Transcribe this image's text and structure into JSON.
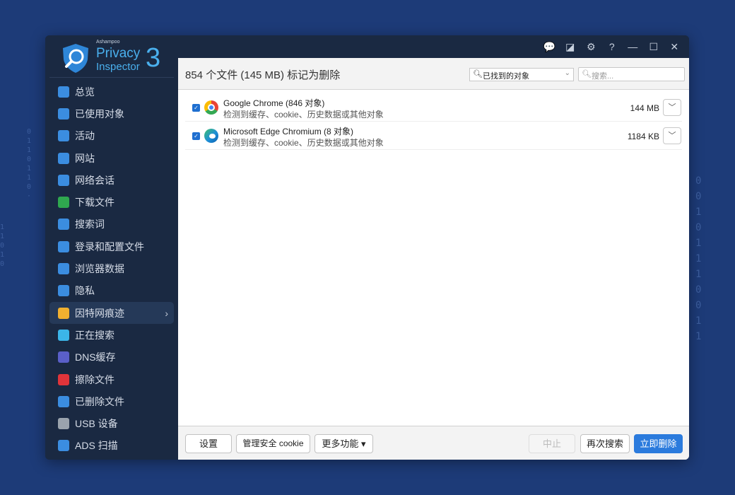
{
  "logo": {
    "brand": "Ashampoo",
    "line1": "Privacy",
    "line2": "Inspector",
    "version": "3"
  },
  "sidebar": {
    "items": [
      {
        "label": "总览",
        "icon": "monitor-icon",
        "color": "#3b8de0"
      },
      {
        "label": "已使用对象",
        "icon": "document-icon",
        "color": "#3b8de0"
      },
      {
        "label": "活动",
        "icon": "activity-chart-icon",
        "color": "#3b8de0"
      },
      {
        "label": "网站",
        "icon": "www-icon",
        "color": "#3b8de0"
      },
      {
        "label": "网络会话",
        "icon": "globe-cursor-icon",
        "color": "#3b8de0"
      },
      {
        "label": "下载文件",
        "icon": "download-icon",
        "color": "#2fa84f"
      },
      {
        "label": "搜索词",
        "icon": "magnifier-icon",
        "color": "#3b8de0"
      },
      {
        "label": "登录和配置文件",
        "icon": "user-icon",
        "color": "#3b8de0"
      },
      {
        "label": "浏览器数据",
        "icon": "browser-window-icon",
        "color": "#3b8de0"
      },
      {
        "label": "隐私",
        "icon": "privacy-shield-icon",
        "color": "#3b8de0"
      },
      {
        "label": "因特网痕迹",
        "icon": "cookie-icon",
        "color": "#f0b030"
      },
      {
        "label": "正在搜索",
        "icon": "eye-icon",
        "color": "#3bb5e8"
      },
      {
        "label": "DNS缓存",
        "icon": "dns-icon",
        "color": "#5a5fc8"
      },
      {
        "label": "擦除文件",
        "icon": "shredder-icon",
        "color": "#e0343a"
      },
      {
        "label": "已删除文件",
        "icon": "recycle-bin-icon",
        "color": "#3b8de0"
      },
      {
        "label": "USB 设备",
        "icon": "usb-icon",
        "color": "#9aa3ad"
      },
      {
        "label": "ADS 扫描",
        "icon": "ads-file-icon",
        "color": "#3b8de0"
      }
    ],
    "active_index": 10
  },
  "titlebar": {
    "icons": [
      "feedback-icon",
      "skin-icon",
      "settings-icon",
      "help-icon",
      "minimize-icon",
      "maximize-icon",
      "close-icon"
    ],
    "glyphs": [
      "💬",
      "◪",
      "⚙",
      "?",
      "—",
      "☐",
      "✕"
    ]
  },
  "header": {
    "title": "854 个文件 (145 MB) 标记为删除",
    "filter": "已找到的对象",
    "search_placeholder": "搜索..."
  },
  "results": [
    {
      "name": "Google Chrome (846 对象)",
      "desc": "检测到缓存、cookie、历史数据或其他对象",
      "size": "144 MB",
      "checked": true
    },
    {
      "name": "Microsoft Edge Chromium (8 对象)",
      "desc": "检测到缓存、cookie、历史数据或其他对象",
      "size": "1184 KB",
      "checked": true
    }
  ],
  "footer": {
    "settings": "设置",
    "manage_cookie": "管理安全 cookie",
    "more": "更多功能 ▾",
    "stop": "中止",
    "rescan": "再次搜索",
    "delete_now": "立即删除"
  }
}
